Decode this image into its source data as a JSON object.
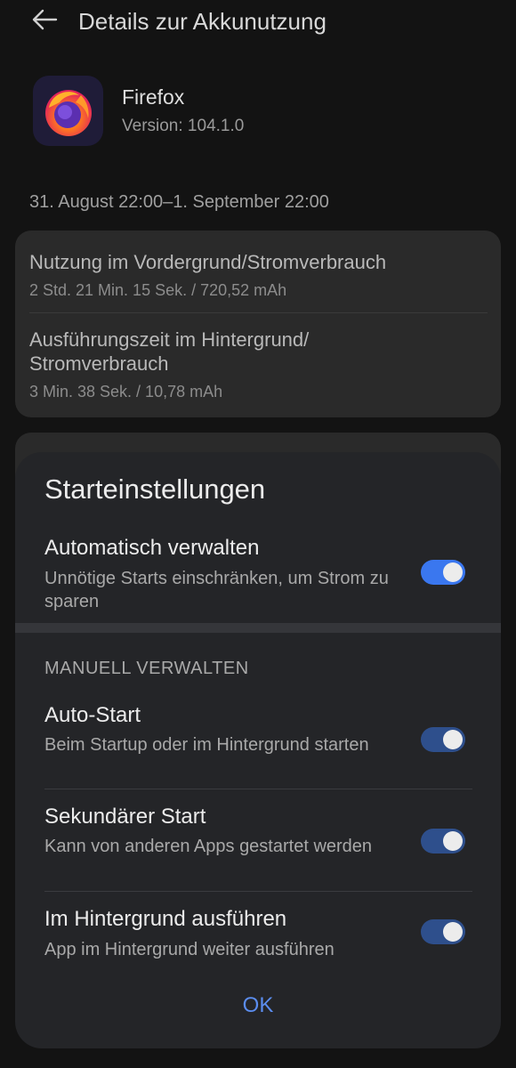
{
  "header": {
    "title": "Details zur Akkunutzung",
    "back_icon": "arrow-left-icon"
  },
  "app": {
    "name": "Firefox",
    "version": "Version: 104.1.0",
    "icon": "firefox-logo-icon"
  },
  "date_range": "31. August 22:00–1. September 22:00",
  "usage": {
    "foreground": {
      "title": "Nutzung im Vordergrund/Stromverbrauch",
      "value": "2 Std. 21 Min. 15 Sek. / 720,52 mAh"
    },
    "background": {
      "title_line1": "Ausführungszeit im Hintergrund/",
      "title_line2": "Stromverbrauch",
      "value": "3 Min. 38 Sek. / 10,78 mAh"
    }
  },
  "dialog": {
    "title": "Starteinstellungen",
    "auto_manage": {
      "title": "Automatisch verwalten",
      "subtitle": "Unnötige Starts einschränken, um Strom zu sparen",
      "enabled": true
    },
    "manual_header": "MANUELL VERWALTEN",
    "items": [
      {
        "title": "Auto-Start",
        "subtitle": "Beim Startup oder im Hintergrund starten",
        "enabled": true
      },
      {
        "title": "Sekundärer Start",
        "subtitle": "Kann von anderen Apps gestartet werden",
        "enabled": true
      },
      {
        "title": "Im Hintergrund ausführen",
        "subtitle": "App im Hintergrund weiter ausführen",
        "enabled": true
      }
    ],
    "ok_label": "OK"
  },
  "colors": {
    "background": "#131313",
    "card": "#2a2a2a",
    "dialog": "#242528",
    "accent": "#5b8def",
    "toggle_on": "#3a77ef",
    "toggle_on_disabled": "#2e4f8c"
  }
}
